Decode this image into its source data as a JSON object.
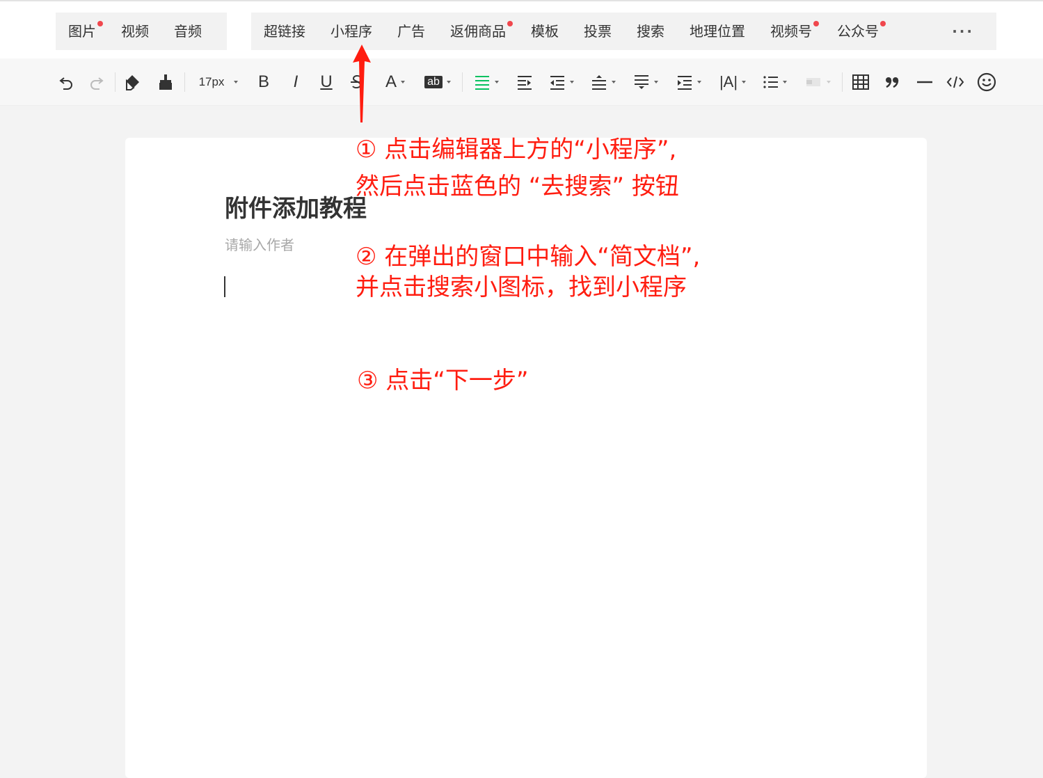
{
  "insert_bar": {
    "group1": [
      {
        "label": "图片",
        "dot": true
      },
      {
        "label": "视频",
        "dot": false
      },
      {
        "label": "音频",
        "dot": false
      }
    ],
    "group2": [
      {
        "label": "超链接",
        "dot": false
      },
      {
        "label": "小程序",
        "dot": false
      },
      {
        "label": "广告",
        "dot": false
      },
      {
        "label": "返佣商品",
        "dot": true
      },
      {
        "label": "模板",
        "dot": false
      },
      {
        "label": "投票",
        "dot": false
      },
      {
        "label": "搜索",
        "dot": false
      },
      {
        "label": "地理位置",
        "dot": false
      },
      {
        "label": "视频号",
        "dot": true
      },
      {
        "label": "公众号",
        "dot": true
      }
    ],
    "more_label": "···"
  },
  "toolbar": {
    "font_size": "17px",
    "bold_label": "B",
    "italic_label": "I",
    "underline_label": "U",
    "font_color_label": "A",
    "highlight_label": "ab",
    "letter_spacing_label": "|A|",
    "icons": [
      "undo-icon",
      "redo-icon",
      "format-eraser-icon",
      "format-painter-icon",
      "strikethrough-icon",
      "align-center-icon",
      "indent-icon",
      "outdent-icon",
      "paragraph-spacing-icon",
      "line-height-icon",
      "first-line-indent-icon",
      "list-icon",
      "background-icon",
      "table-icon",
      "quote-icon",
      "divider-icon",
      "code-icon",
      "emoji-icon"
    ],
    "accent_color": "#07c160"
  },
  "document": {
    "title": "附件添加教程",
    "author_placeholder": "请输入作者"
  },
  "annotations": {
    "step1_line1": "① 点击编辑器上方的“小程序”,",
    "step1_line2": "然后点击蓝色的 “去搜索” 按钮",
    "step2_line1": "② 在弹出的窗口中输入“简文档”,",
    "step2_line2": "并点击搜索小图标，找到小程序",
    "step3": "③ 点击“下一步”",
    "color": "#ff1d10"
  }
}
